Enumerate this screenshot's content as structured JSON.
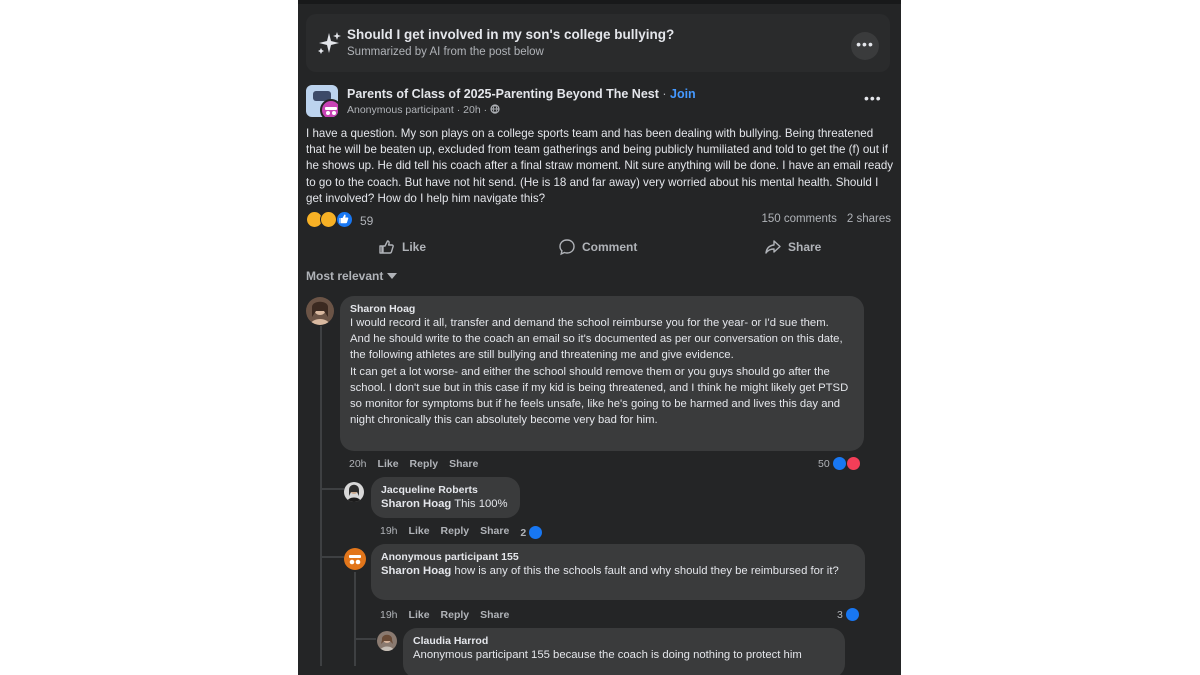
{
  "ai_summary": {
    "title": "Should I get involved in my son's college bullying?",
    "subtitle": "Summarized by AI from the post below",
    "more_icon": "ellipsis-icon",
    "more_label": "•••"
  },
  "post": {
    "group_name": "Parents of Class of 2025-Parenting Beyond The Nest",
    "separator": " · ",
    "join_label": "Join",
    "author": "Anonymous participant",
    "time": "20h",
    "meta_separator": " · ",
    "privacy_icon": "globe-icon",
    "more_label": "•••",
    "body": "I have a question. My son plays on a college sports team and has been dealing with bullying. Being threatened that he will be beaten up, excluded from team gatherings and being publicly humiliated and told to get the (f) out if he shows up. He did tell his coach after a final straw moment. Nit sure anything will be done. I have an email ready to go to the coach. But have not hit send. (He is 18 and far away) very worried about his mental health. Should I get involved? How do I help him navigate this?",
    "reaction_count": "59",
    "comments_count": "150 comments",
    "shares_count": "2 shares",
    "like_label": "Like",
    "comment_label": "Comment",
    "share_label": "Share"
  },
  "sort_label": "Most relevant",
  "comments": [
    {
      "name": "Sharon Hoag",
      "text_1": "I would record it all, transfer and demand the school reimburse you for the year- or I'd sue them.",
      "text_2": "And he should write to the coach an email so it's documented as per our conversation on this date, the following athletes are still bullying and threatening me and give evidence.",
      "text_3": "It can get a lot worse- and either the school should remove them or you guys should go after the school. I don't sue but in this case if my kid is being threatened, and I think he might likely get PTSD so monitor for symptoms but if he feels unsafe, like he's going to be harmed and lives this day and night chronically this can absolutely become very bad for him.",
      "time": "20h",
      "like": "Like",
      "reply": "Reply",
      "share": "Share",
      "likes": "50"
    },
    {
      "name": "Jacqueline Roberts",
      "mention": "Sharon Hoag",
      "text": " This 100%",
      "time": "19h",
      "like": "Like",
      "reply": "Reply",
      "share": "Share",
      "likes": "2"
    },
    {
      "name": "Anonymous participant 155",
      "mention": "Sharon Hoag",
      "text": " how is any of this the schools fault and why should they be reimbursed for it?",
      "time": "19h",
      "like": "Like",
      "reply": "Reply",
      "share": "Share",
      "likes": "3"
    },
    {
      "name": "Claudia Harrod",
      "text": "Anonymous participant 155 because the coach is doing nothing to protect him"
    }
  ],
  "colors": {
    "background": "#242526",
    "bubble": "#3a3b3c",
    "link": "#4599ff",
    "like_blue": "#1877f2",
    "love_red": "#f33e58",
    "haha_yellow": "#f7b125"
  }
}
